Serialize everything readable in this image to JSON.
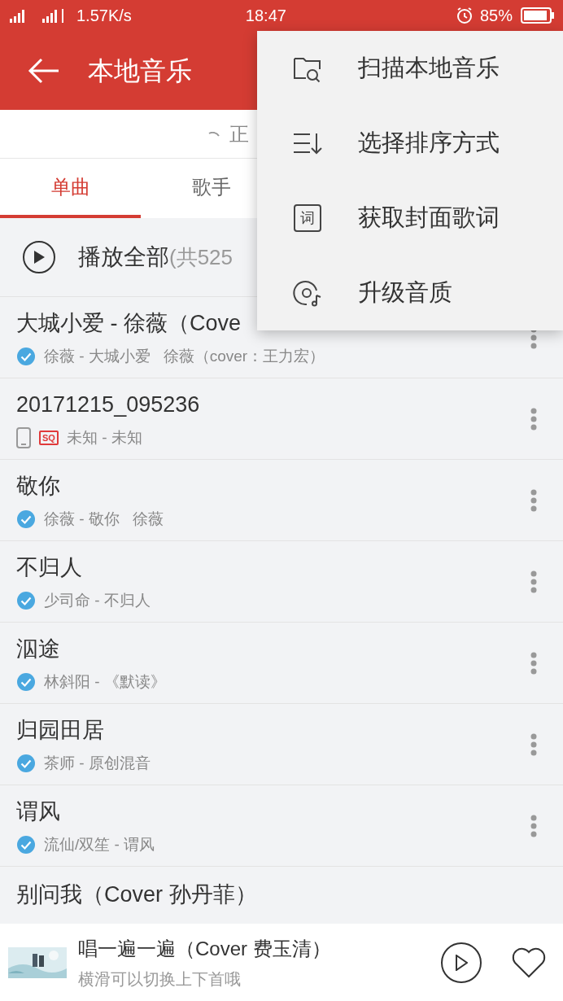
{
  "status_bar": {
    "speed": "1.57K/s",
    "time": "18:47",
    "battery": "85%"
  },
  "header": {
    "title": "本地音乐"
  },
  "scan_status": {
    "text": "正"
  },
  "tabs": [
    {
      "label": "单曲",
      "selected": true
    },
    {
      "label": "歌手",
      "selected": false
    }
  ],
  "play_all": {
    "label": "播放全部",
    "count": "(共525"
  },
  "songs": [
    {
      "title": "大城小爱 - 徐薇（Cove",
      "subtitle": "徐薇 - 大城小爱   徐薇（cover：王力宏）",
      "kind": "verified"
    },
    {
      "title": "20171215_095236",
      "subtitle": "未知 - 未知",
      "kind": "device",
      "badge": "SQ"
    },
    {
      "title": "敬你",
      "subtitle": "徐薇 - 敬你   徐薇",
      "kind": "verified"
    },
    {
      "title": "不归人",
      "subtitle": "少司命 - 不归人",
      "kind": "verified"
    },
    {
      "title": "泅途",
      "subtitle": "林斜阳 - 《默读》",
      "kind": "verified"
    },
    {
      "title": "归园田居",
      "subtitle": "茶师 - 原创混音",
      "kind": "verified"
    },
    {
      "title": "谓风",
      "subtitle": "流仙/双笙 - 谓风",
      "kind": "verified"
    },
    {
      "title": "别问我（Cover 孙丹菲）",
      "kind": "partial"
    }
  ],
  "menu": [
    {
      "label": "扫描本地音乐",
      "kind": "scan"
    },
    {
      "label": "选择排序方式",
      "kind": "sort"
    },
    {
      "label": "获取封面歌词",
      "kind": "lyrics",
      "icon_text": "词"
    },
    {
      "label": "升级音质",
      "kind": "quality"
    }
  ],
  "player": {
    "title": "唱一遍一遍（Cover 费玉清）",
    "hint": "横滑可以切换上下首哦"
  }
}
